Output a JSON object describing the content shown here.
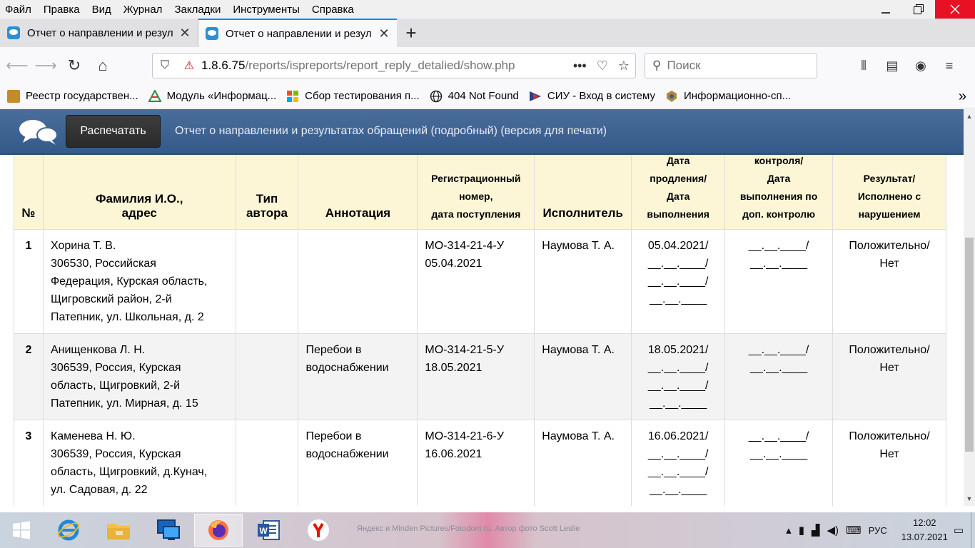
{
  "menubar": {
    "items": [
      "Файл",
      "Правка",
      "Вид",
      "Журнал",
      "Закладки",
      "Инструменты",
      "Справка"
    ]
  },
  "tabs": [
    {
      "title": "Отчет о направлении и резул",
      "active": false
    },
    {
      "title": "Отчет о направлении и резул",
      "active": true
    }
  ],
  "navbar": {
    "url_host": "1.8.6.75",
    "url_path": "/reports/ispreports/report_reply_detalied/show.php",
    "search_placeholder": "Поиск"
  },
  "bookmarks": [
    {
      "label": "Реестр государствен...",
      "icon": "registry-icon"
    },
    {
      "label": "Модуль «Информац...",
      "icon": "module-icon"
    },
    {
      "label": "Сбор тестирования п...",
      "icon": "collection-icon"
    },
    {
      "label": "404 Not Found",
      "icon": "globe-icon"
    },
    {
      "label": "СИУ - Вход в систему",
      "icon": "siu-icon"
    },
    {
      "label": "Информационно-сп...",
      "icon": "info-icon"
    }
  ],
  "app": {
    "print_label": "Распечатать",
    "title": "Отчет о направлении и результатах обращений (подробный) (версия для печати)"
  },
  "table": {
    "headers": {
      "num": "№",
      "name_line1": "Фамилия И.О.,",
      "name_line2": "адрес",
      "author_line1": "Тип",
      "author_line2": "автора",
      "annotation": "Аннотация",
      "reg_line1": "Регистрационный",
      "reg_line2": "номер,",
      "reg_line3": "дата поступления",
      "executor": "Исполнитель",
      "date_line0": "Дата",
      "date_line1": "продления/",
      "date_line2": "Дата",
      "date_line3": "выполнения",
      "control_line0": "контроля/",
      "control_line1": "Дата",
      "control_line2": "выполнения по",
      "control_line3": "доп. контролю",
      "result_line1": "Результат/",
      "result_line2": "Исполнено с",
      "result_line3": "нарушением"
    },
    "rows": [
      {
        "num": "1",
        "name": "Хорина Т. В.",
        "addr1": "306530, Российская",
        "addr2": "Федерация, Курская область,",
        "addr3": "Щигровский район, 2-й",
        "addr4": "Патепник, ул. Школьная, д. 2",
        "author_type": "",
        "annotation1": "",
        "annotation2": "",
        "reg_number": "МО-314-21-4-У",
        "reg_date": "05.04.2021",
        "executor": "Наумова Т. А.",
        "date1": "05.04.2021/",
        "date2": "__.__.____/",
        "date3": "__.__.____/",
        "date4": "__.__.____",
        "ctrl1": "__.__.____/",
        "ctrl2": "__.__.____",
        "result1": "Положительно/",
        "result2": "Нет"
      },
      {
        "num": "2",
        "name": "Анищенкова Л. Н.",
        "addr1": "306539, Россия, Курская",
        "addr2": "область, Щигровкий, 2-й",
        "addr3": "Патепник, ул. Мирная, д. 15",
        "addr4": "",
        "author_type": "",
        "annotation1": "Перебои в",
        "annotation2": "водоснабжении",
        "reg_number": "МО-314-21-5-У",
        "reg_date": "18.05.2021",
        "executor": "Наумова Т. А.",
        "date1": "18.05.2021/",
        "date2": "__.__.____/",
        "date3": "__.__.____/",
        "date4": "__.__.____",
        "ctrl1": "__.__.____/",
        "ctrl2": "__.__.____",
        "result1": "Положительно/",
        "result2": "Нет"
      },
      {
        "num": "3",
        "name": "Каменева Н. Ю.",
        "addr1": "306539, Россия, Курская",
        "addr2": "область, Щигровкий, д.Кунач,",
        "addr3": "ул. Садовая, д. 22",
        "addr4": "",
        "author_type": "",
        "annotation1": "Перебои в",
        "annotation2": "водоснабжении",
        "reg_number": "МО-314-21-6-У",
        "reg_date": "16.06.2021",
        "executor": "Наумова Т. А.",
        "date1": "16.06.2021/",
        "date2": "__.__.____/",
        "date3": "__.__.____/",
        "date4": "__.__.____",
        "ctrl1": "__.__.____/",
        "ctrl2": "__.__.____",
        "result1": "Положительно/",
        "result2": "Нет"
      }
    ]
  },
  "taskbar": {
    "watermark": "Яндекс и Minden Pictures/Fotodom.ru. Автор фото Scott Leslie",
    "lang": "РУС",
    "time": "12:02",
    "date": "13.07.2021"
  },
  "colors": {
    "header_bg": "#3f6594",
    "table_header_bg": "#fcf6d7",
    "active_tab_accent": "#0a84ff"
  }
}
